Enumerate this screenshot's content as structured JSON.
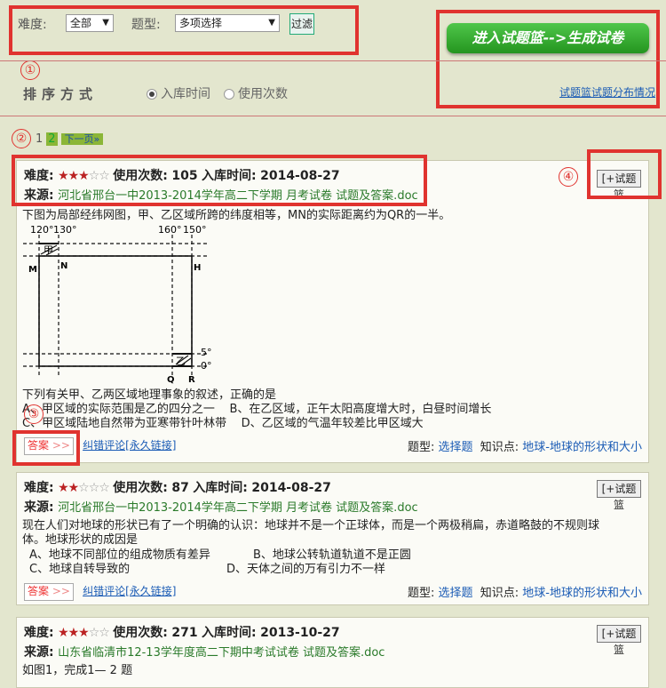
{
  "filter": {
    "difficulty_label": "难度:",
    "difficulty_value": "全部",
    "type_label": "题型:",
    "type_value": "多项选择",
    "filter_button": "过滤"
  },
  "basket": {
    "button": "进入试题篮-->生成试卷",
    "dist_link": "试题篮试题分布情况"
  },
  "annotations": {
    "n1": "①",
    "n2": "②",
    "n3": "③",
    "n4": "④"
  },
  "sort": {
    "title": "排序方式",
    "opt_time": "入库时间",
    "opt_usage": "使用次数"
  },
  "pager": {
    "current": "1",
    "page2": "2",
    "next": "下一页»"
  },
  "common": {
    "difficulty_key": "难度:",
    "usage_key": "使用次数:",
    "time_key": "入库时间:",
    "source_key": "来源:",
    "add_basket": "[+试题篮",
    "answer": "答案",
    "answer_arrow": ">>",
    "error_link": "纠错评论[永久链接]",
    "type_key": "题型:",
    "knowledge_key": "知识点:"
  },
  "questions": [
    {
      "stars_filled": "★★★",
      "stars_empty": "☆☆",
      "usage": "105",
      "time": "2014-08-27",
      "source": "河北省邢台一中2013-2014学年高二下学期 月考试卷 试题及答案.doc",
      "intro": "下图为局部经纬网图，甲、乙区域所跨的纬度相等，MN的实际距离约为QR的一半。",
      "stem": "下列有关甲、乙两区域地理事象的叙述，正确的是",
      "opt_a": "A、甲区域的实际范围是乙的四分之一",
      "opt_b": "B、在乙区域，正午太阳高度增大时，白昼时间增长",
      "opt_c": "C、甲区域陆地自然带为亚寒带针叶林带",
      "opt_d": "D、乙区域的气温年较差比甲区域大",
      "qtype": "选择题",
      "knowledge": "地球-地球的形状和大小",
      "figure": {
        "lon_120": "120°",
        "lon_130": "130°",
        "lon_160": "160°",
        "lon_150": "150°",
        "lat_5": "5°",
        "lat_0": "0°",
        "m": "M",
        "n": "N",
        "h": "H",
        "q": "Q",
        "r": "R",
        "jia": "甲",
        "yi": "乙"
      }
    },
    {
      "stars_filled": "★★",
      "stars_empty": "☆☆☆",
      "usage": "87",
      "time": "2014-08-27",
      "source": "河北省邢台一中2013-2014学年高二下学期 月考试卷 试题及答案.doc",
      "stem1": "现在人们对地球的形状已有了一个明确的认识：地球并不是一个正球体，而是一个两极稍扁，赤道略鼓的不规则球",
      "stem2": "体。地球形状的成因是",
      "opt_a": "A、地球不同部位的组成物质有差异",
      "opt_b": "B、地球公转轨道轨道不是正圆",
      "opt_c": "C、地球自转导致的",
      "opt_d": "D、天体之间的万有引力不一样",
      "qtype": "选择题",
      "knowledge": "地球-地球的形状和大小"
    },
    {
      "stars_filled": "★★★",
      "stars_empty": "☆☆",
      "usage": "271",
      "time": "2013-10-27",
      "source": "山东省临清市12-13学年度高二下期中考试试卷 试题及答案.doc",
      "stem": "如图1，完成1— 2 题"
    }
  ]
}
